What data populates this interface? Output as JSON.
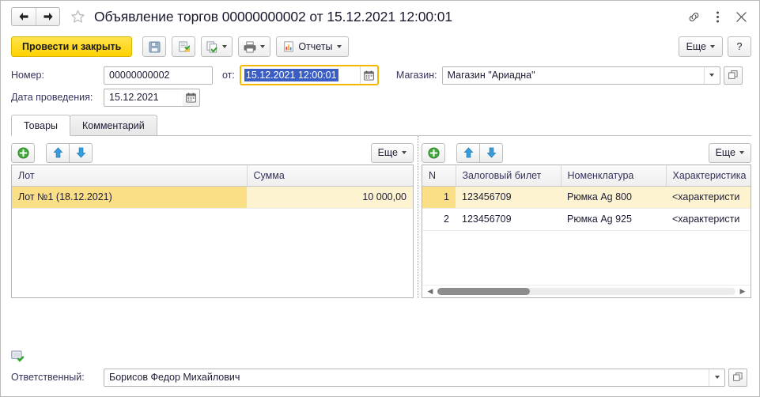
{
  "titlebar": {
    "back_icon": "arrow-left-icon",
    "forward_icon": "arrow-right-icon",
    "favorite_icon": "star-icon",
    "title": "Объявление торгов 00000000002 от 15.12.2021 12:00:01",
    "link_icon": "link-icon",
    "menu_icon": "kebab-menu-icon",
    "close_icon": "close-icon"
  },
  "commandbar": {
    "post_and_close": "Провести и закрыть",
    "save_icon": "floppy-save-icon",
    "post_icon": "document-post-icon",
    "create_based_on_icon": "create-based-on-icon",
    "print_icon": "printer-icon",
    "reports_icon": "report-chart-icon",
    "reports_label": "Отчеты",
    "more_label": "Еще",
    "help_label": "?"
  },
  "fields": {
    "number_label": "Номер:",
    "number_value": "00000000002",
    "date_label": "от:",
    "date_value": "15.12.2021 12:00:01",
    "calendar_icon": "calendar-icon",
    "posting_date_label": "Дата проведения:",
    "posting_date_value": "15.12.2021",
    "shop_label": "Магазин:",
    "shop_value": "Магазин \"Ариадна\"",
    "dropdown_icon": "chevron-down-icon",
    "open_icon": "open-window-icon"
  },
  "tabs": [
    {
      "label": "Товары",
      "active": true
    },
    {
      "label": "Комментарий",
      "active": false
    }
  ],
  "left_grid": {
    "toolbar": {
      "add_icon": "add-green-plus-icon",
      "move_up_icon": "arrow-up-blue-icon",
      "move_down_icon": "arrow-down-blue-icon",
      "more_label": "Еще"
    },
    "columns": [
      "Лот",
      "Сумма"
    ],
    "rows": [
      {
        "lot": "Лот №1 (18.12.2021)",
        "sum": "10 000,00",
        "selected": true
      }
    ]
  },
  "right_grid": {
    "toolbar": {
      "add_icon": "add-green-plus-icon",
      "move_up_icon": "arrow-up-blue-icon",
      "move_down_icon": "arrow-down-blue-icon",
      "more_label": "Еще"
    },
    "columns": [
      "N",
      "Залоговый билет",
      "Номенклатура",
      "Характеристика"
    ],
    "rows": [
      {
        "n": "1",
        "ticket": "123456709",
        "item": "Рюмка Ag 800",
        "char": "<характеристи",
        "selected": true
      },
      {
        "n": "2",
        "ticket": "123456709",
        "item": "Рюмка Ag 925",
        "char": "<характеристи",
        "selected": false
      }
    ],
    "scroll": {
      "left_arrow_icon": "scroll-left-arrow-icon",
      "right_arrow_icon": "scroll-right-arrow-icon"
    }
  },
  "footer": {
    "status_icon": "window-check-icon",
    "responsible_label": "Ответственный:",
    "responsible_value": "Борисов Федор Михайлович",
    "dropdown_icon": "chevron-down-icon",
    "open_icon": "open-window-icon"
  },
  "colors": {
    "accent_yellow": "#ffd200",
    "focus_border": "#f5b700",
    "selection_blue": "#3b5ec4",
    "row_selected": "#fdf3d0",
    "key_cell_selected": "#fbdf86",
    "label_text": "#33335c"
  }
}
